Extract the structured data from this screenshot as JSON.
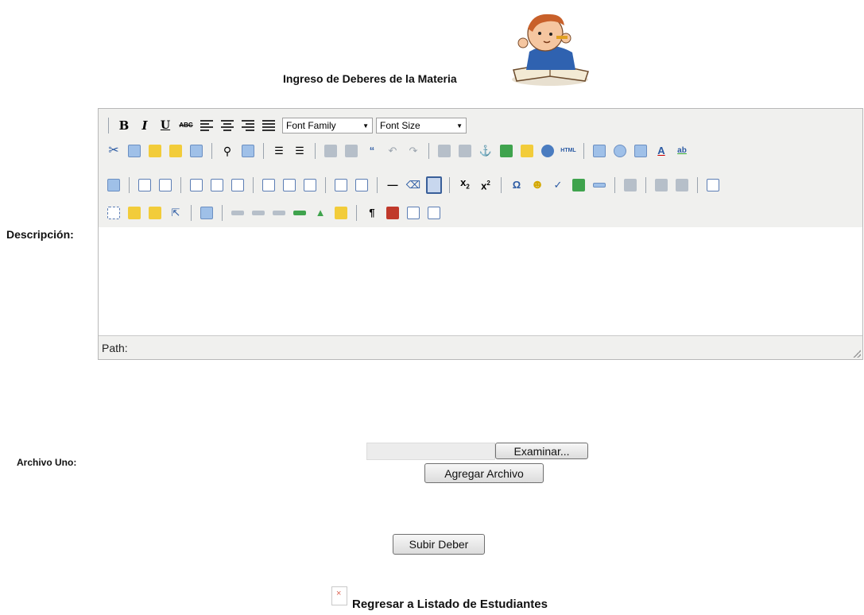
{
  "header": {
    "title": "Ingreso de Deberes de la Materia"
  },
  "form": {
    "description_label": "Descripción:",
    "editor": {
      "font_family": "Font Family",
      "font_size": "Font Size",
      "path_label": "Path:",
      "toolbar_text": {
        "bold": "B",
        "italic": "I",
        "underline": "U",
        "strike": "ABC",
        "omega": "Ω",
        "pilcrow": "¶",
        "hr": "—"
      },
      "content": ""
    },
    "file_label": "Archivo Uno:",
    "browse_button": "Examinar...",
    "add_file_button": "Agregar Archivo",
    "submit_button": "Subir Deber"
  },
  "footer": {
    "back_link": "Regresar a Listado de Estudiantes"
  }
}
